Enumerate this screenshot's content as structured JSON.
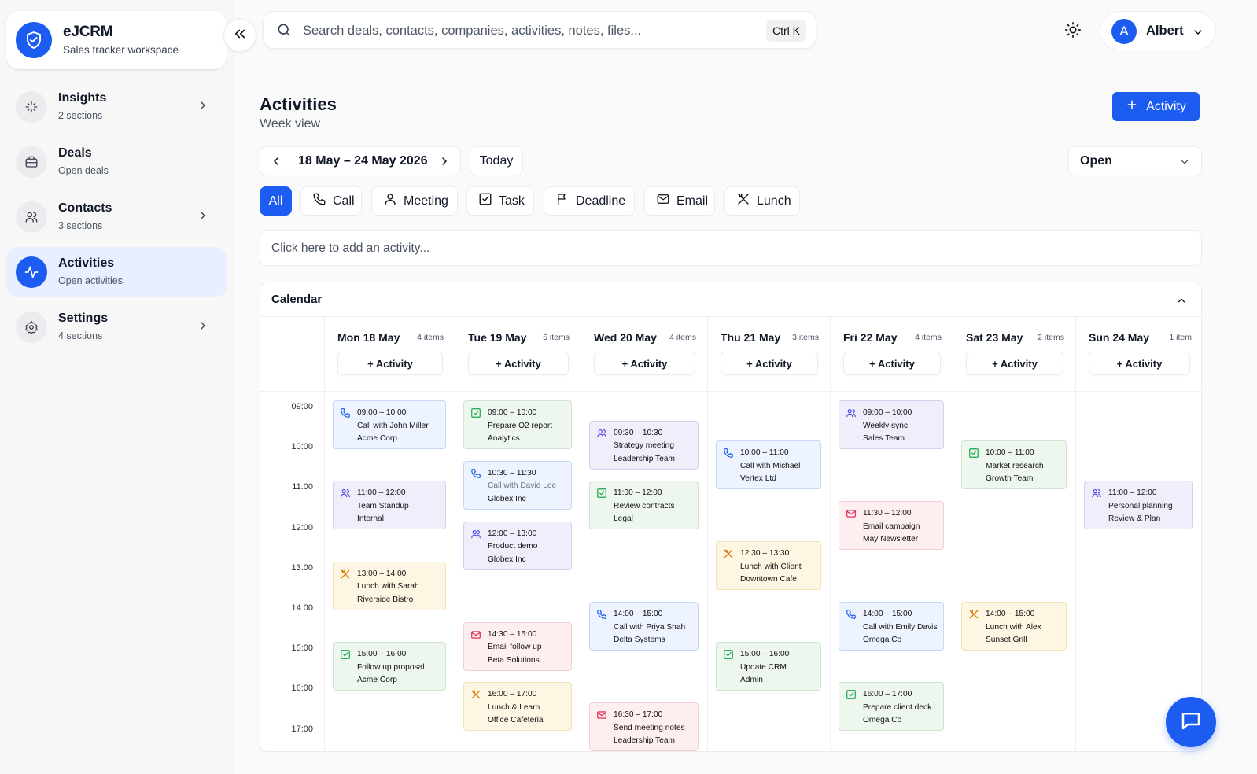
{
  "brand": {
    "name": "eJCRM",
    "subtitle": "Sales tracker workspace"
  },
  "sidebar": {
    "items": [
      {
        "label": "Insights",
        "sub": "2 sections",
        "icon": "sparkles-icon"
      },
      {
        "label": "Deals",
        "sub": "Open deals",
        "icon": "briefcase-icon"
      },
      {
        "label": "Contacts",
        "sub": "3 sections",
        "icon": "users-icon"
      },
      {
        "label": "Activities",
        "sub": "Open activities",
        "icon": "activity-pulse-icon",
        "active": true
      },
      {
        "label": "Settings",
        "sub": "4 sections",
        "icon": "gear-icon"
      }
    ]
  },
  "topbar": {
    "search_placeholder": "Search deals, contacts, companies, activities, notes, files...",
    "shortcut": "Ctrl K",
    "user": {
      "initial": "A",
      "name": "Albert"
    }
  },
  "header": {
    "title": "Activities",
    "subtitle": "Week view",
    "add_button": "Activity",
    "date_range": "18 May – 24 May 2026",
    "today": "Today",
    "status_value": "Open"
  },
  "filters": [
    {
      "label": "All",
      "active": true
    },
    {
      "label": "Call",
      "icon": "phone-icon"
    },
    {
      "label": "Meeting",
      "icon": "user-icon"
    },
    {
      "label": "Task",
      "icon": "checkbox-icon"
    },
    {
      "label": "Deadline",
      "icon": "flag-icon"
    },
    {
      "label": "Email",
      "icon": "mail-icon"
    },
    {
      "label": "Lunch",
      "icon": "utensils-icon"
    }
  ],
  "quick_add": {
    "placeholder": "Click here to add an activity..."
  },
  "calendar": {
    "title": "Calendar",
    "add_label": "+ Activity",
    "hours": [
      "09:00",
      "10:00",
      "11:00",
      "12:00",
      "13:00",
      "14:00",
      "15:00",
      "16:00",
      "17:00"
    ],
    "days": [
      {
        "name": "Mon 18 May",
        "count": "4 items",
        "events": [
          {
            "type": "call",
            "time": "09:00 – 10:00",
            "title": "Call with John Miller",
            "sub": "Acme Corp",
            "start": 9.0
          },
          {
            "type": "meeting",
            "time": "11:00 – 12:00",
            "title": "Team Standup",
            "sub": "Internal",
            "start": 11.0
          },
          {
            "type": "lunch",
            "time": "13:00 – 14:00",
            "title": "Lunch with Sarah",
            "sub": "Riverside Bistro",
            "start": 13.0
          },
          {
            "type": "task",
            "time": "15:00 – 16:00",
            "title": "Follow up proposal",
            "sub": "Acme Corp",
            "start": 15.0
          }
        ]
      },
      {
        "name": "Tue 19 May",
        "count": "5 items",
        "events": [
          {
            "type": "task",
            "time": "09:00 – 10:00",
            "title": "Prepare Q2 report",
            "sub": "Analytics",
            "start": 9.0
          },
          {
            "type": "call",
            "time": "10:30 – 11:30",
            "title": "Call with David Lee",
            "sub": "Globex Inc",
            "start": 10.5,
            "muted_title": true
          },
          {
            "type": "meeting",
            "time": "12:00 – 13:00",
            "title": "Product demo",
            "sub": "Globex Inc",
            "start": 12.0
          },
          {
            "type": "email",
            "time": "14:30 – 15:00",
            "title": "Email follow up",
            "sub": "Beta Solutions",
            "start": 14.5
          },
          {
            "type": "lunch",
            "time": "16:00 – 17:00",
            "title": "Lunch & Learn",
            "sub": "Office Cafeteria",
            "start": 16.0
          }
        ]
      },
      {
        "name": "Wed 20 May",
        "count": "4 items",
        "events": [
          {
            "type": "meeting",
            "time": "09:30 – 10:30",
            "title": "Strategy meeting",
            "sub": "Leadership Team",
            "start": 9.5
          },
          {
            "type": "task",
            "time": "11:00 – 12:00",
            "title": "Review contracts",
            "sub": "Legal",
            "start": 11.0
          },
          {
            "type": "call",
            "time": "14:00 – 15:00",
            "title": "Call with Priya Shah",
            "sub": "Delta Systems",
            "start": 14.0
          },
          {
            "type": "email",
            "time": "16:30 – 17:00",
            "title": "Send meeting notes",
            "sub": "Leadership Team",
            "start": 16.5
          }
        ]
      },
      {
        "name": "Thu 21 May",
        "count": "3 items",
        "events": [
          {
            "type": "call",
            "time": "10:00 – 11:00",
            "title": "Call with Michael",
            "sub": "Vertex Ltd",
            "start": 10.0
          },
          {
            "type": "lunch",
            "time": "12:30 – 13:30",
            "title": "Lunch with Client",
            "sub": "Downtown Cafe",
            "start": 12.5
          },
          {
            "type": "task",
            "time": "15:00 – 16:00",
            "title": "Update CRM",
            "sub": "Admin",
            "start": 15.0
          }
        ]
      },
      {
        "name": "Fri 22 May",
        "count": "4 items",
        "events": [
          {
            "type": "meeting",
            "time": "09:00 – 10:00",
            "title": "Weekly sync",
            "sub": "Sales Team",
            "start": 9.0
          },
          {
            "type": "email",
            "time": "11:30 – 12:00",
            "title": "Email campaign",
            "sub": "May Newsletter",
            "start": 11.5
          },
          {
            "type": "call",
            "time": "14:00 – 15:00",
            "title": "Call with Emily Davis",
            "sub": "Omega Co",
            "start": 14.0
          },
          {
            "type": "task",
            "time": "16:00 – 17:00",
            "title": "Prepare client deck",
            "sub": "Omega Co",
            "start": 16.0
          }
        ]
      },
      {
        "name": "Sat 23 May",
        "count": "2 items",
        "events": [
          {
            "type": "task",
            "time": "10:00 – 11:00",
            "title": "Market research",
            "sub": "Growth Team",
            "start": 10.0
          },
          {
            "type": "lunch",
            "time": "14:00 – 15:00",
            "title": "Lunch with Alex",
            "sub": "Sunset Grill",
            "start": 14.0
          }
        ]
      },
      {
        "name": "Sun 24 May",
        "count": "1 item",
        "events": [
          {
            "type": "meeting",
            "time": "11:00 – 12:00",
            "title": "Personal planning",
            "sub": "Review & Plan",
            "start": 11.0
          }
        ]
      }
    ]
  },
  "colors": {
    "accent": "#1d5cf0",
    "call": "#1d5cf0",
    "meeting": "#4f46e5",
    "task": "#16a34a",
    "lunch": "#d97706",
    "email": "#e11d48"
  }
}
